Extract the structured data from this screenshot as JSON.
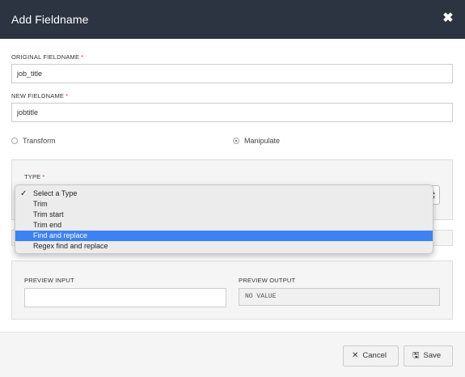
{
  "header": {
    "title": "Add Fieldname",
    "close_icon": "✖"
  },
  "original": {
    "label": "ORIGINAL FIELDNAME",
    "required": "*",
    "value": "job_title"
  },
  "new_field": {
    "label": "NEW FIELDNAME",
    "required": "*",
    "value": "jobtitle"
  },
  "mode": {
    "transform_label": "Transform",
    "manipulate_label": "Manipulate",
    "selected": "Manipulate"
  },
  "type": {
    "label": "TYPE",
    "required": "*",
    "options": [
      "Select a Type",
      "Trim",
      "Trim start",
      "Trim end",
      "Find and replace",
      "Regex find and replace"
    ],
    "checked_option": "Select a Type",
    "highlighted_option": "Find and replace"
  },
  "preview": {
    "input_label": "PREVIEW INPUT",
    "input_value": "",
    "output_label": "PREVIEW OUTPUT",
    "output_value": "NO VALUE"
  },
  "footer": {
    "cancel_label": "Cancel",
    "save_label": "Save"
  },
  "colors": {
    "header_bg": "#2c3442",
    "highlight": "#3b82f6",
    "required": "#c0392b"
  }
}
